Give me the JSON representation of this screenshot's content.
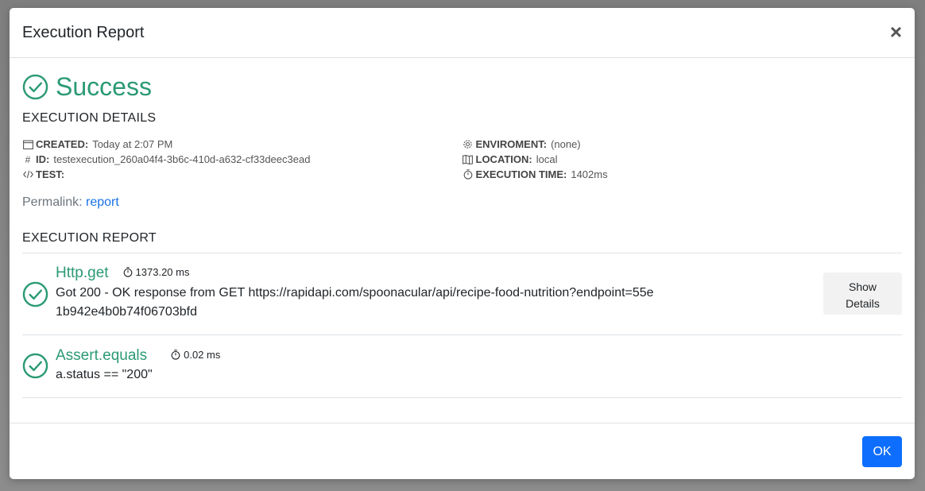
{
  "modal": {
    "title": "Execution Report",
    "close_symbol": "×",
    "status": "Success",
    "status_color": "#2b9a74"
  },
  "details": {
    "section_title": "EXECUTION DETAILS",
    "created_label": "CREATED:",
    "created_value": "Today at 2:07 PM",
    "id_label": "ID:",
    "id_value": "testexecution_260a04f4-3b6c-410d-a632-cf33deec3ead",
    "test_label": "TEST:",
    "test_value": "",
    "environment_label": "ENVIROMENT:",
    "environment_value": "(none)",
    "location_label": "LOCATION:",
    "location_value": "local",
    "exec_time_label": "EXECUTION TIME:",
    "exec_time_value": "1402ms",
    "icons": {
      "created": "calendar-icon",
      "id": "hash-icon",
      "test": "code-icon",
      "environment": "gear-icon",
      "location": "map-icon",
      "exec_time": "stopwatch-icon"
    }
  },
  "permalink": {
    "label": "Permalink:",
    "link_text": "report",
    "link_color": "#1a73e8"
  },
  "report": {
    "section_title": "EXECUTION REPORT",
    "steps": [
      {
        "name": "Http.get",
        "time": "1373.20 ms",
        "message": "Got 200 - OK response from GET https://rapidapi.com/spoonacular/api/recipe-food-nutrition?endpoint=55e1b942e4b0b74f06703bfd",
        "button_line1": "Show",
        "button_line2": "Details"
      },
      {
        "name": "Assert.equals",
        "time": "0.02 ms",
        "message": "a.status == \"200\""
      }
    ]
  },
  "footer": {
    "ok_label": "OK",
    "ok_color": "#0d6efd"
  }
}
